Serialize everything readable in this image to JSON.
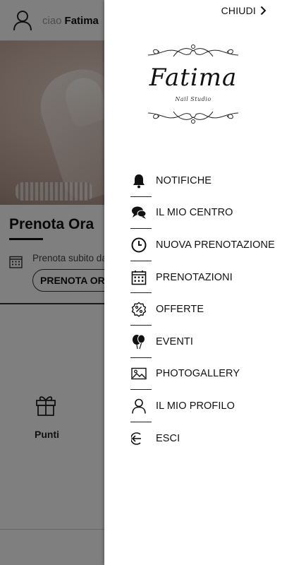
{
  "header": {
    "greeting": "ciao",
    "user_name": "Fatima"
  },
  "booking": {
    "title": "Prenota Ora",
    "subtitle": "Prenota subito da",
    "button_label": "PRENOTA ORA"
  },
  "points": {
    "label": "Punti"
  },
  "drawer": {
    "close_label": "CHIUDI",
    "logo": {
      "name": "Fatima",
      "tagline": "Nail Studio"
    },
    "menu": [
      {
        "label": "NOTIFICHE",
        "icon": "bell-icon"
      },
      {
        "label": "IL MIO CENTRO",
        "icon": "chat-bubbles-icon"
      },
      {
        "label": "NUOVA PRENOTAZIONE",
        "icon": "clock-icon"
      },
      {
        "label": "PRENOTAZIONI",
        "icon": "calendar-icon"
      },
      {
        "label": "OFFERTE",
        "icon": "percent-badge-icon"
      },
      {
        "label": "EVENTI",
        "icon": "balloons-icon"
      },
      {
        "label": "PHOTOGALLERY",
        "icon": "image-icon"
      },
      {
        "label": "IL MIO PROFILO",
        "icon": "user-icon"
      },
      {
        "label": "ESCI",
        "icon": "logout-icon"
      }
    ]
  }
}
